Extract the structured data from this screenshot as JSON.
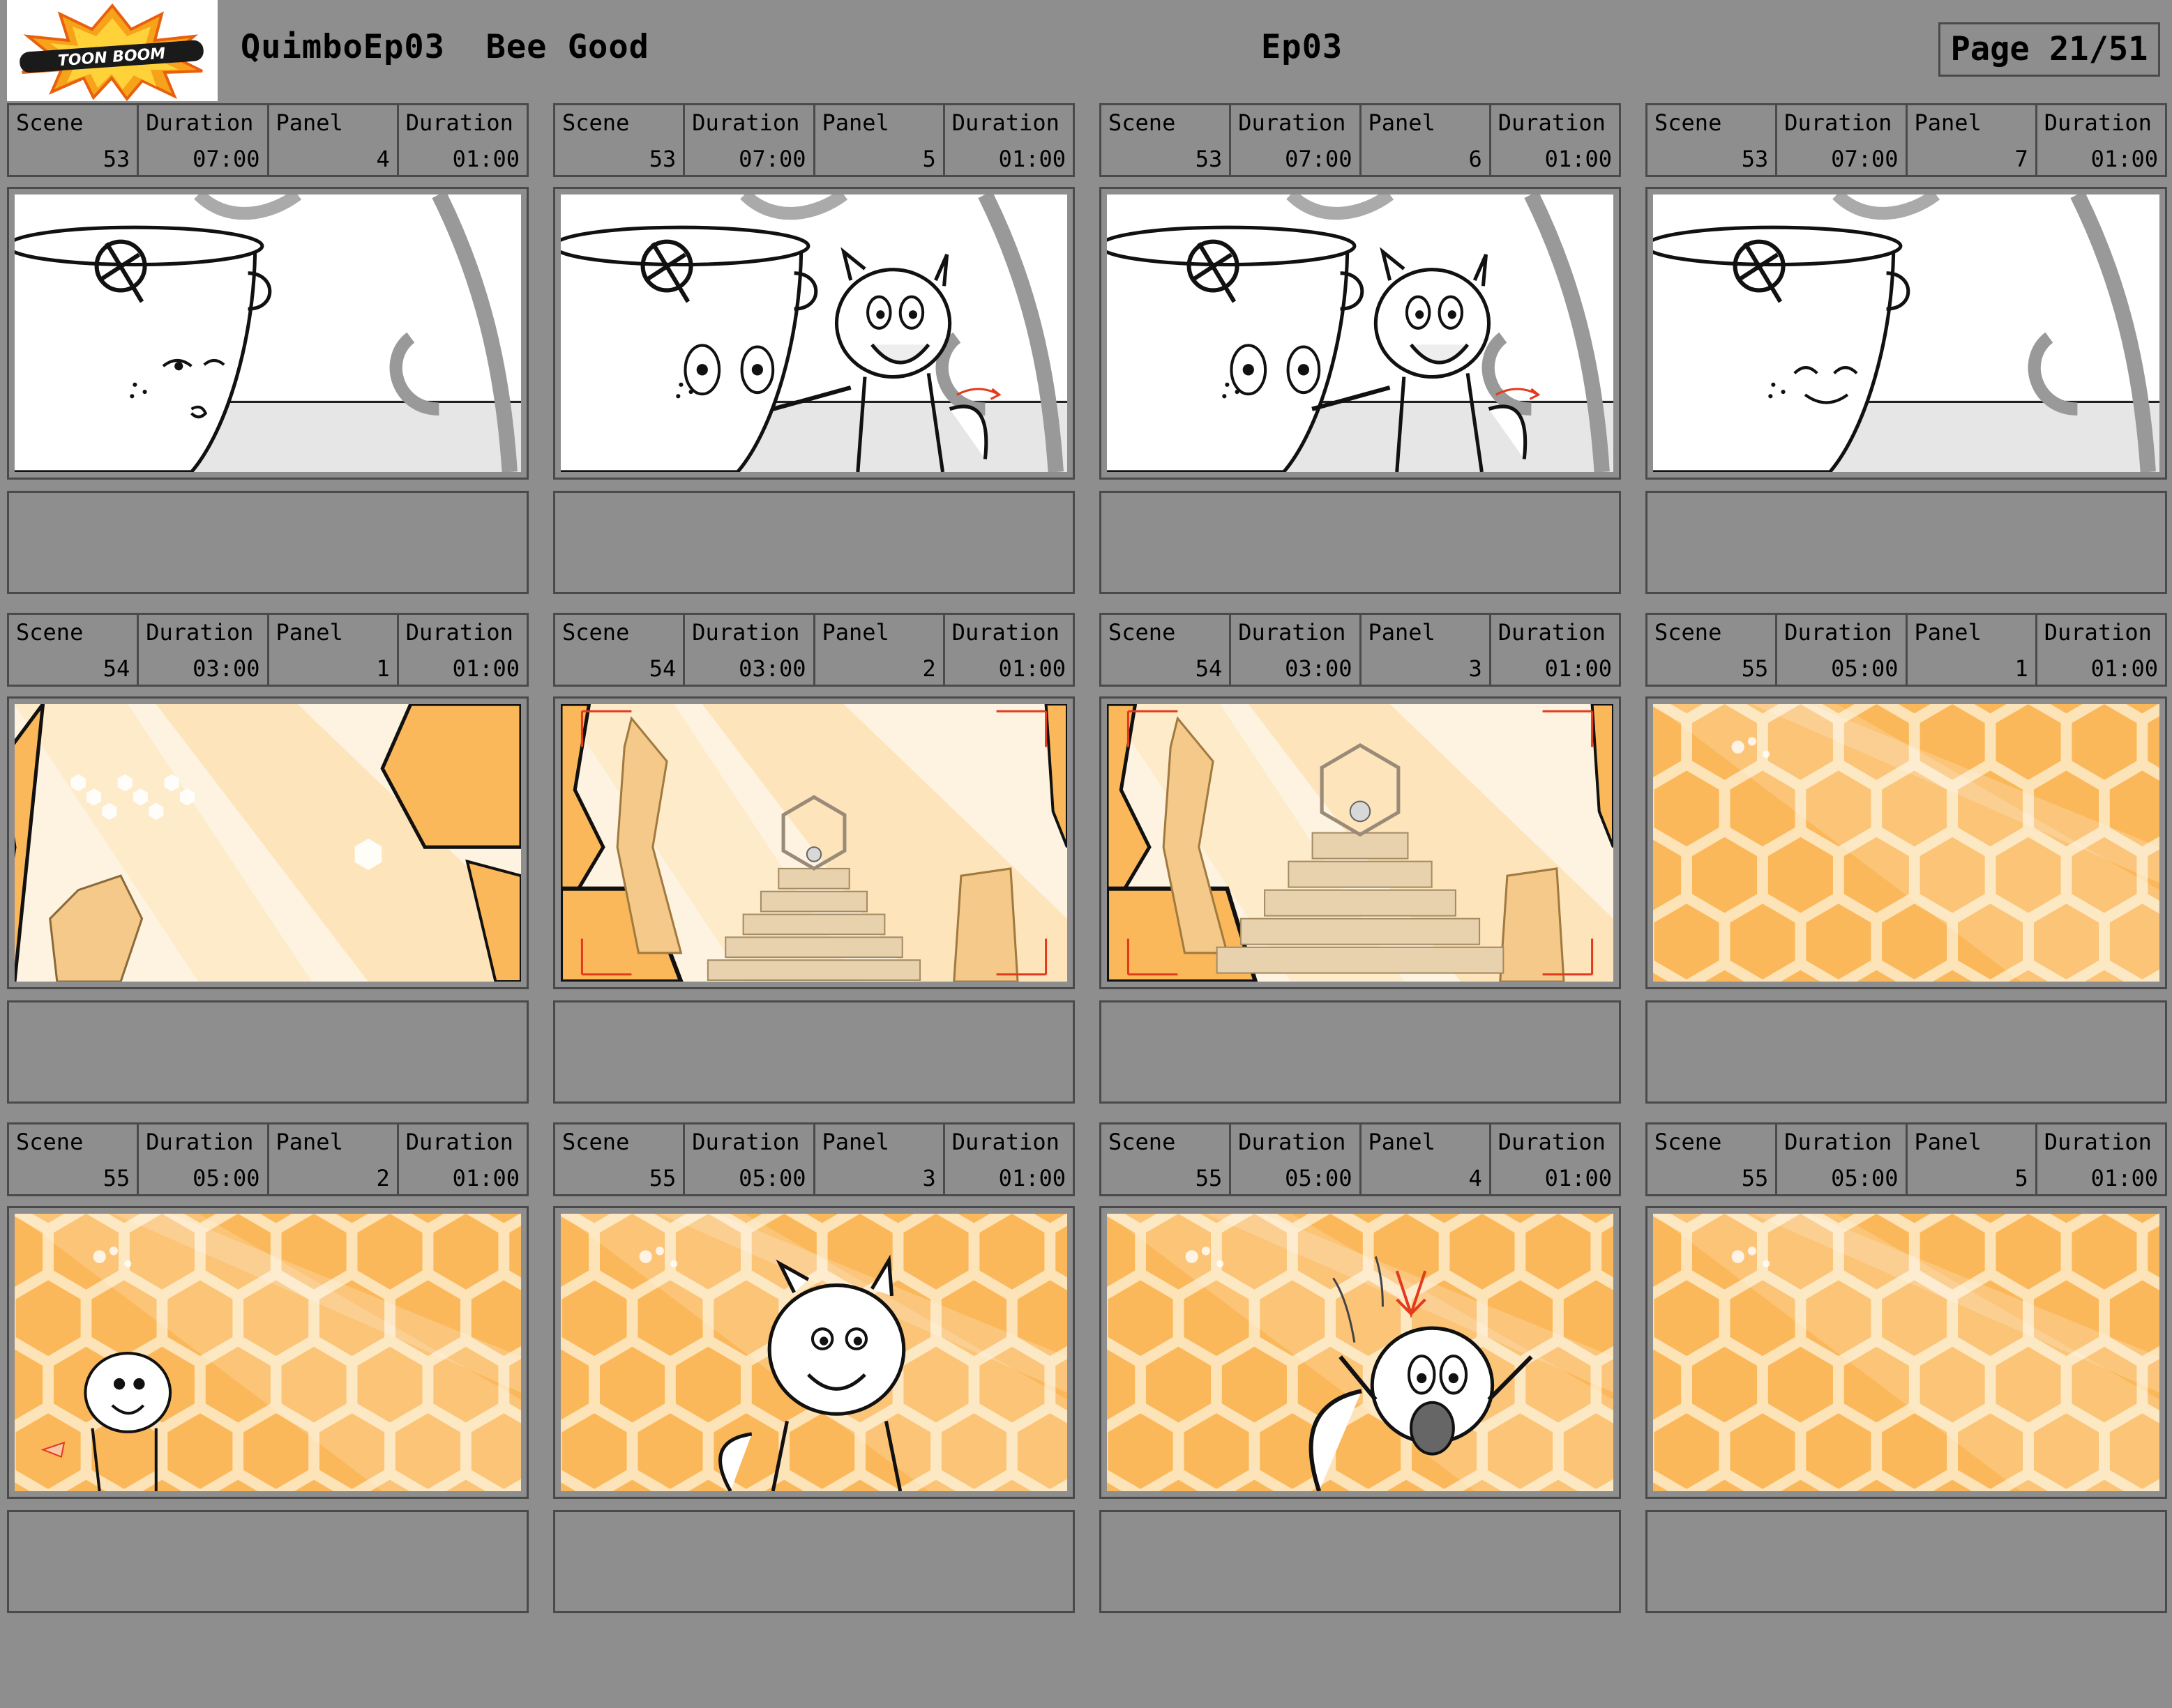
{
  "header": {
    "logo_text": "TOON BOOM",
    "project": "QuimboEp03",
    "episode_title": "Bee Good",
    "episode_code": "Ep03",
    "page": "Page 21/51"
  },
  "labels": {
    "scene": "Scene",
    "duration": "Duration",
    "panel": "Panel"
  },
  "colors": {
    "background": "#8e8e8e",
    "border": "#4a4a4a",
    "honey": "#fbb85a",
    "honey_light": "#fde3b8"
  },
  "panels": [
    {
      "scene": "53",
      "scene_duration": "07:00",
      "panel": "4",
      "panel_duration": "01:00",
      "art": "cup-scene-sleepy"
    },
    {
      "scene": "53",
      "scene_duration": "07:00",
      "panel": "5",
      "panel_duration": "01:00",
      "art": "cup-scene-squirrel-pointing"
    },
    {
      "scene": "53",
      "scene_duration": "07:00",
      "panel": "6",
      "panel_duration": "01:00",
      "art": "cup-scene-squirrel-pointing-back"
    },
    {
      "scene": "53",
      "scene_duration": "07:00",
      "panel": "7",
      "panel_duration": "01:00",
      "art": "cup-scene-smiling"
    },
    {
      "scene": "54",
      "scene_duration": "03:00",
      "panel": "1",
      "panel_duration": "01:00",
      "art": "hive-interior-light"
    },
    {
      "scene": "54",
      "scene_duration": "03:00",
      "panel": "2",
      "panel_duration": "01:00",
      "art": "hive-throne-room"
    },
    {
      "scene": "54",
      "scene_duration": "03:00",
      "panel": "3",
      "panel_duration": "01:00",
      "art": "hive-throne-room-closer"
    },
    {
      "scene": "55",
      "scene_duration": "05:00",
      "panel": "1",
      "panel_duration": "01:00",
      "art": "honeycomb-background"
    },
    {
      "scene": "55",
      "scene_duration": "05:00",
      "panel": "2",
      "panel_duration": "01:00",
      "art": "honeycomb-squirrel-small"
    },
    {
      "scene": "55",
      "scene_duration": "05:00",
      "panel": "3",
      "panel_duration": "01:00",
      "art": "honeycomb-squirrel-medium"
    },
    {
      "scene": "55",
      "scene_duration": "05:00",
      "panel": "4",
      "panel_duration": "01:00",
      "art": "honeycomb-squirrel-surprised"
    },
    {
      "scene": "55",
      "scene_duration": "05:00",
      "panel": "5",
      "panel_duration": "01:00",
      "art": "honeycomb-background-empty"
    }
  ]
}
